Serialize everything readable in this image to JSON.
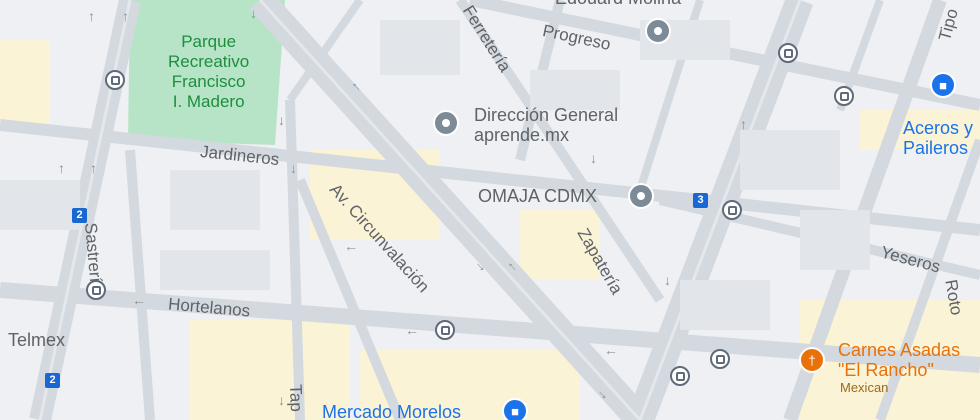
{
  "park": {
    "line1": "Parque",
    "line2": "Recreativo",
    "line3": "Francisco",
    "line4": "I. Madero"
  },
  "streets": {
    "jardineros": "Jardineros",
    "sastreria": "Sastrería",
    "hortelanos": "Hortelanos",
    "circunvalacion": "Av. Circunvalación",
    "ferreteria": "Ferretería",
    "progreso": "Progreso",
    "zapateria": "Zapatería",
    "yeseros": "Yeseros",
    "tipo": "Tipo",
    "roto": "Roto",
    "tap": "Tap"
  },
  "places": {
    "direccion_line1": "Dirección General",
    "direccion_line2": "aprende.mx",
    "omaja": "OMAJA CDMX",
    "aceros_line1": "Aceros y",
    "aceros_line2": "Paileros",
    "carnes_line1": "Carnes Asadas",
    "carnes_line2": "\"El Rancho\"",
    "carnes_category": "Mexican",
    "mercado": "Mercado Morelos",
    "telmex": "Telmex",
    "top_partial": "Edouard Molina"
  },
  "routes": {
    "r2": "2",
    "r3": "3"
  },
  "icons": {
    "pin_generic": "place-pin-icon",
    "pin_shopping": "shopping-bag-icon",
    "pin_cart": "shopping-cart-icon",
    "pin_food": "restaurant-icon",
    "pin_school": "school-icon",
    "bus": "bus-stop-icon",
    "arrow": "one-way-arrow-icon"
  },
  "colors": {
    "park": "#b7e4c7",
    "road": "#cfd5dc",
    "block": "#e8ebef",
    "highlight": "#fbf3d5",
    "route": "#1967d2"
  }
}
